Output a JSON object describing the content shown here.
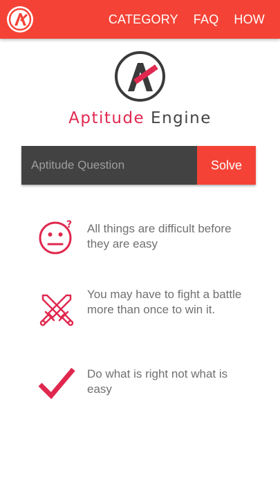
{
  "nav": {
    "links": [
      "CATEGORY",
      "FAQ",
      "HOW"
    ],
    "logo_icon": "aptitude-engine-logo"
  },
  "brand": {
    "name_part1": "Aptitude",
    "name_part2": "Engine",
    "logo_icon": "pencil-a-logo"
  },
  "search": {
    "placeholder": "Aptitude Question",
    "value": "",
    "button_label": "Solve"
  },
  "quotes": [
    {
      "icon": "confused-face-icon",
      "text": "All things are difficult before they are easy"
    },
    {
      "icon": "crossed-swords-icon",
      "text": "You may have to fight a battle more than once to win it."
    },
    {
      "icon": "checkmark-icon",
      "text": "Do what is right not what is easy"
    }
  ],
  "colors": {
    "primary": "#f44336",
    "accent": "#e0284f",
    "dark": "#424242"
  }
}
